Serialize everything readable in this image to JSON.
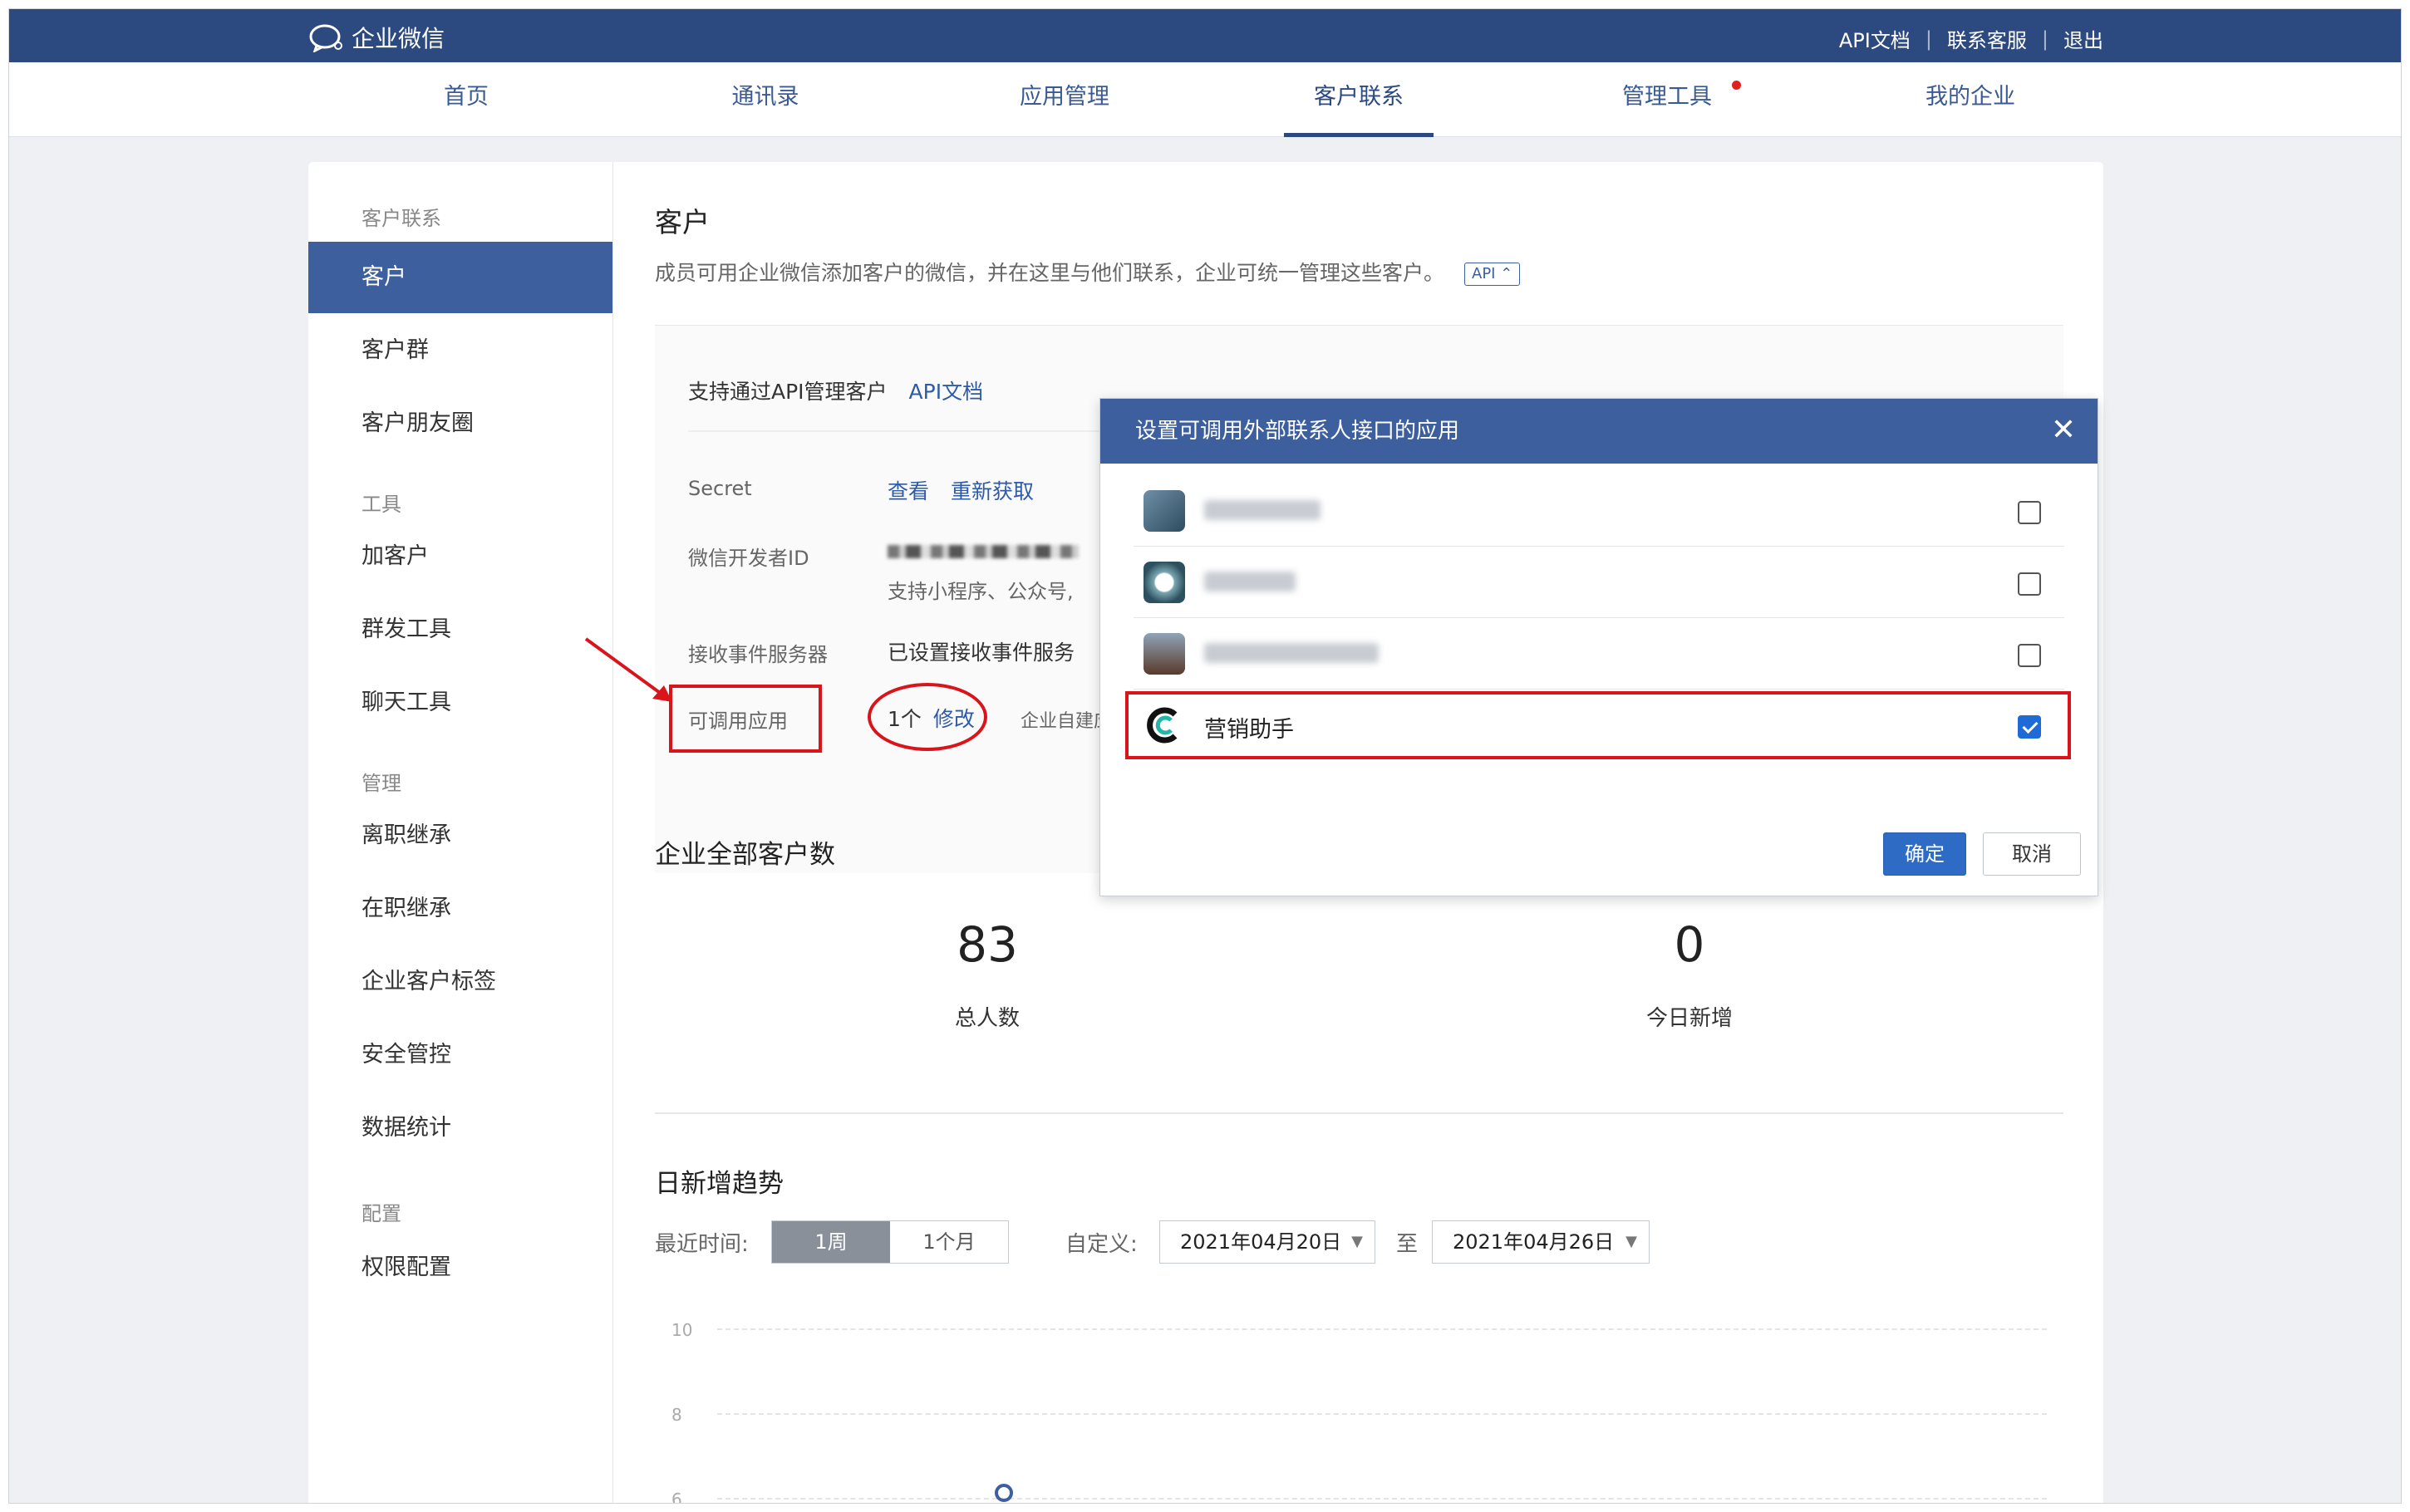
{
  "topbar": {
    "logo_text": "企业微信",
    "links": [
      "API文档",
      "联系客服",
      "退出"
    ]
  },
  "nav": {
    "items": [
      "首页",
      "通讯录",
      "应用管理",
      "客户联系",
      "管理工具",
      "我的企业"
    ],
    "active": "客户联系",
    "badge_on": "管理工具"
  },
  "sidebar": {
    "sections": [
      {
        "title": "客户联系",
        "items": [
          "客户",
          "客户群",
          "客户朋友圈"
        ]
      },
      {
        "title": "工具",
        "items": [
          "加客户",
          "群发工具",
          "聊天工具"
        ]
      },
      {
        "title": "管理",
        "items": [
          "离职继承",
          "在职继承",
          "企业客户标签",
          "安全管控",
          "数据统计"
        ]
      },
      {
        "title": "配置",
        "items": [
          "权限配置"
        ]
      }
    ],
    "active": "客户"
  },
  "main": {
    "title": "客户",
    "desc": "成员可用企业微信添加客户的微信，并在这里与他们联系，企业可统一管理这些客户。",
    "api_badge": "API ⌃",
    "api_support": "支持通过API管理客户",
    "api_doc_link": "API文档",
    "secret_label": "Secret",
    "secret_view": "查看",
    "secret_refresh": "重新获取",
    "devid_label": "微信开发者ID",
    "devid_note": "支持小程序、公众号,",
    "event_label": "接收事件服务器",
    "event_value": "已设置接收事件服务",
    "apps_label": "可调用应用",
    "apps_count": "1个",
    "apps_edit": "修改",
    "apps_note": "企业自建应",
    "total_title": "企业全部客户数",
    "total_count": "83",
    "total_label": "总人数",
    "today_count": "0",
    "today_label": "今日新增",
    "trend_title": "日新增趋势",
    "recent_label": "最近时间:",
    "seg_week": "1周",
    "seg_month": "1个月",
    "custom_label": "自定义:",
    "date_from": "2021年04月20日",
    "to_label": "至",
    "date_to": "2021年04月26日",
    "y_ticks": [
      "10",
      "8",
      "6"
    ]
  },
  "modal": {
    "title": "设置可调用外部联系人接口的应用",
    "close": "✕",
    "apps": [
      {
        "name": "",
        "checked": false
      },
      {
        "name": "",
        "checked": false
      },
      {
        "name": "",
        "checked": false
      },
      {
        "name": "营销助手",
        "checked": true
      }
    ],
    "ok": "确定",
    "cancel": "取消"
  },
  "colors": {
    "brand": "#2c4a7f",
    "accent": "#3d5f9e",
    "highlight": "#d9141b"
  }
}
